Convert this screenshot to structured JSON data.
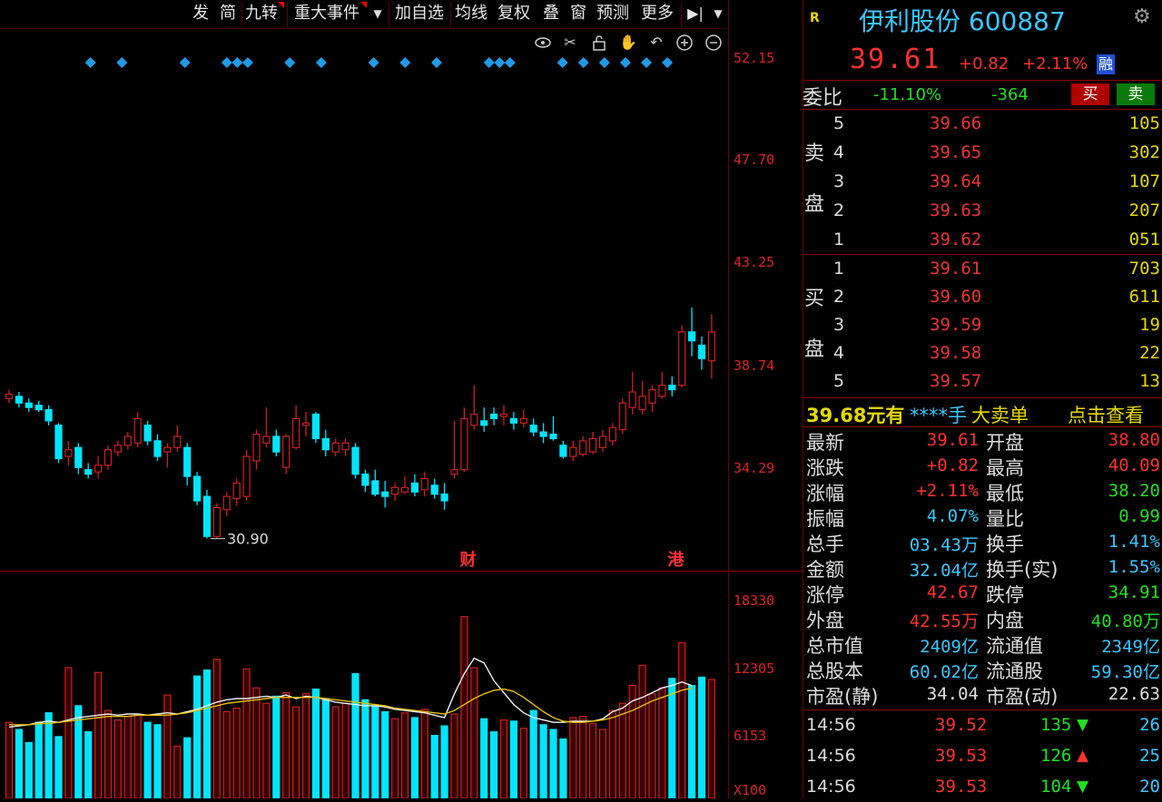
{
  "toolbar": {
    "items": [
      "发",
      "简",
      "九转",
      "重大事件",
      "加自选",
      "均线",
      "复权",
      "叠",
      "窗",
      "预测",
      "更多"
    ],
    "dropdown_icon": "chevron-down-icon",
    "play_icon": "skip-next-icon"
  },
  "chart_tools": [
    "eye-icon",
    "scissors-icon",
    "lock-icon",
    "hand-icon",
    "undo-icon",
    "zoom-in-icon",
    "zoom-out-icon"
  ],
  "price_axis": [
    "52.15",
    "47.70",
    "43.25",
    "38.74",
    "34.29"
  ],
  "volume_axis": [
    "18330",
    "12305",
    "6153",
    "X100"
  ],
  "low_marker": "30.90",
  "event_markers": [
    "财",
    "港"
  ],
  "chart_data": [
    {
      "type": "candlestick",
      "ylim": [
        29.5,
        53.5
      ],
      "low_label": "30.90",
      "candles": [
        {
          "o": 37.2,
          "c": 37.4,
          "h": 37.6,
          "l": 37.0
        },
        {
          "o": 37.3,
          "c": 37.0,
          "h": 37.5,
          "l": 36.8
        },
        {
          "o": 37.0,
          "c": 36.8,
          "h": 37.2,
          "l": 36.6
        },
        {
          "o": 36.9,
          "c": 36.7,
          "h": 37.1,
          "l": 36.6
        },
        {
          "o": 36.7,
          "c": 36.2,
          "h": 36.9,
          "l": 36.0
        },
        {
          "o": 36.0,
          "c": 34.5,
          "h": 36.1,
          "l": 34.3
        },
        {
          "o": 34.6,
          "c": 34.9,
          "h": 35.3,
          "l": 34.2
        },
        {
          "o": 35.0,
          "c": 34.1,
          "h": 35.2,
          "l": 33.8
        },
        {
          "o": 34.0,
          "c": 33.8,
          "h": 34.3,
          "l": 33.6
        },
        {
          "o": 33.9,
          "c": 34.2,
          "h": 34.6,
          "l": 33.6
        },
        {
          "o": 34.2,
          "c": 34.9,
          "h": 35.1,
          "l": 34.0
        },
        {
          "o": 34.8,
          "c": 35.1,
          "h": 35.3,
          "l": 34.6
        },
        {
          "o": 35.1,
          "c": 35.5,
          "h": 35.7,
          "l": 34.9
        },
        {
          "o": 35.2,
          "c": 36.3,
          "h": 36.6,
          "l": 35.0
        },
        {
          "o": 36.0,
          "c": 35.3,
          "h": 36.2,
          "l": 35.1
        },
        {
          "o": 35.3,
          "c": 34.6,
          "h": 35.6,
          "l": 34.4
        },
        {
          "o": 34.8,
          "c": 35.0,
          "h": 35.2,
          "l": 34.1
        },
        {
          "o": 35.0,
          "c": 35.5,
          "h": 36.0,
          "l": 34.8
        },
        {
          "o": 35.0,
          "c": 33.7,
          "h": 35.2,
          "l": 33.3
        },
        {
          "o": 33.7,
          "c": 32.6,
          "h": 33.9,
          "l": 32.4
        },
        {
          "o": 32.8,
          "c": 31.0,
          "h": 33.1,
          "l": 30.9
        },
        {
          "o": 31.0,
          "c": 32.3,
          "h": 32.5,
          "l": 30.9
        },
        {
          "o": 32.2,
          "c": 32.8,
          "h": 33.0,
          "l": 31.9
        },
        {
          "o": 32.7,
          "c": 33.4,
          "h": 33.6,
          "l": 32.4
        },
        {
          "o": 32.8,
          "c": 34.6,
          "h": 34.9,
          "l": 32.6
        },
        {
          "o": 34.4,
          "c": 35.6,
          "h": 35.8,
          "l": 34.0
        },
        {
          "o": 35.2,
          "c": 35.5,
          "h": 36.8,
          "l": 35.0
        },
        {
          "o": 35.5,
          "c": 34.8,
          "h": 35.8,
          "l": 34.6
        },
        {
          "o": 34.1,
          "c": 35.5,
          "h": 35.6,
          "l": 33.8
        },
        {
          "o": 35.0,
          "c": 36.3,
          "h": 36.9,
          "l": 34.9
        },
        {
          "o": 36.0,
          "c": 36.1,
          "h": 36.6,
          "l": 35.5
        },
        {
          "o": 36.5,
          "c": 35.4,
          "h": 36.6,
          "l": 35.2
        },
        {
          "o": 35.4,
          "c": 34.9,
          "h": 35.8,
          "l": 34.6
        },
        {
          "o": 34.8,
          "c": 35.2,
          "h": 35.4,
          "l": 34.6
        },
        {
          "o": 34.9,
          "c": 35.2,
          "h": 35.4,
          "l": 34.6
        },
        {
          "o": 35.0,
          "c": 33.8,
          "h": 35.2,
          "l": 33.6
        },
        {
          "o": 33.8,
          "c": 33.3,
          "h": 34.0,
          "l": 33.0
        },
        {
          "o": 33.5,
          "c": 32.9,
          "h": 34.0,
          "l": 32.8
        },
        {
          "o": 33.0,
          "c": 32.8,
          "h": 33.5,
          "l": 32.3
        },
        {
          "o": 32.9,
          "c": 33.2,
          "h": 33.4,
          "l": 32.6
        },
        {
          "o": 33.0,
          "c": 33.2,
          "h": 33.7,
          "l": 32.9
        },
        {
          "o": 33.4,
          "c": 33.0,
          "h": 33.8,
          "l": 32.8
        },
        {
          "o": 33.1,
          "c": 33.6,
          "h": 33.9,
          "l": 32.8
        },
        {
          "o": 33.3,
          "c": 32.9,
          "h": 33.6,
          "l": 32.7
        },
        {
          "o": 32.9,
          "c": 32.6,
          "h": 33.4,
          "l": 32.2
        },
        {
          "o": 33.8,
          "c": 34.0,
          "h": 36.2,
          "l": 33.6
        },
        {
          "o": 34.0,
          "c": 36.3,
          "h": 36.8,
          "l": 33.9
        },
        {
          "o": 36.0,
          "c": 36.5,
          "h": 37.8,
          "l": 35.8
        },
        {
          "o": 36.2,
          "c": 36.0,
          "h": 36.8,
          "l": 35.7
        },
        {
          "o": 36.5,
          "c": 36.3,
          "h": 36.8,
          "l": 36.0
        },
        {
          "o": 36.4,
          "c": 36.5,
          "h": 36.9,
          "l": 36.0
        },
        {
          "o": 36.3,
          "c": 36.1,
          "h": 36.6,
          "l": 35.8
        },
        {
          "o": 36.1,
          "c": 36.3,
          "h": 36.7,
          "l": 35.9
        },
        {
          "o": 36.0,
          "c": 35.7,
          "h": 36.3,
          "l": 35.5
        },
        {
          "o": 35.7,
          "c": 35.5,
          "h": 36.1,
          "l": 35.2
        },
        {
          "o": 35.6,
          "c": 35.4,
          "h": 36.4,
          "l": 35.3
        },
        {
          "o": 35.1,
          "c": 34.6,
          "h": 35.3,
          "l": 34.5
        },
        {
          "o": 34.6,
          "c": 35.0,
          "h": 35.3,
          "l": 34.4
        },
        {
          "o": 34.7,
          "c": 35.3,
          "h": 35.5,
          "l": 34.6
        },
        {
          "o": 34.8,
          "c": 35.4,
          "h": 35.7,
          "l": 34.7
        },
        {
          "o": 35.0,
          "c": 35.5,
          "h": 35.8,
          "l": 34.8
        },
        {
          "o": 35.3,
          "c": 35.9,
          "h": 36.1,
          "l": 35.1
        },
        {
          "o": 35.8,
          "c": 37.0,
          "h": 37.2,
          "l": 35.6
        },
        {
          "o": 36.8,
          "c": 37.5,
          "h": 38.4,
          "l": 36.5
        },
        {
          "o": 36.7,
          "c": 37.3,
          "h": 38.0,
          "l": 36.5
        },
        {
          "o": 37.0,
          "c": 37.6,
          "h": 37.8,
          "l": 36.6
        },
        {
          "o": 37.3,
          "c": 37.8,
          "h": 38.4,
          "l": 37.2
        },
        {
          "o": 37.8,
          "c": 37.6,
          "h": 38.2,
          "l": 37.3
        },
        {
          "o": 37.8,
          "c": 40.2,
          "h": 40.5,
          "l": 37.7
        },
        {
          "o": 40.2,
          "c": 39.8,
          "h": 41.3,
          "l": 39.1
        },
        {
          "o": 39.6,
          "c": 39.0,
          "h": 40.0,
          "l": 38.5
        },
        {
          "o": 38.9,
          "c": 40.2,
          "h": 41.0,
          "l": 38.1
        }
      ],
      "event_days": [
        {
          "label": "财",
          "index": 45
        },
        {
          "label": "港",
          "index": 66
        }
      ],
      "signal_days": [
        3,
        6,
        12,
        16,
        17,
        18,
        22,
        25,
        30,
        33,
        36,
        41,
        42,
        43,
        48,
        50,
        52,
        54,
        56,
        58
      ]
    },
    {
      "type": "bar",
      "title": "volume",
      "ylim": [
        0,
        18330
      ],
      "values": [
        6400,
        5800,
        4700,
        6400,
        7200,
        5200,
        11000,
        7800,
        5600,
        10600,
        7400,
        6600,
        6900,
        7000,
        6400,
        6200,
        8700,
        4400,
        5100,
        10300,
        10800,
        11700,
        7300,
        7600,
        10900,
        9300,
        8000,
        8600,
        8900,
        7700,
        8800,
        9200,
        8400,
        7700,
        8000,
        10500,
        8300,
        7800,
        7300,
        6700,
        7200,
        6800,
        7500,
        5300,
        6100,
        7100,
        15300,
        11000,
        6700,
        5600,
        6600,
        6500,
        5900,
        7400,
        6200,
        5800,
        5000,
        6800,
        6900,
        6300,
        5800,
        7400,
        8000,
        9500,
        11200,
        8800,
        9300,
        10100,
        13100,
        9500,
        10200,
        10000
      ],
      "ma_series": [
        {
          "values": [
            6000,
            6100,
            6200,
            6400,
            6500,
            6400,
            6600,
            6800,
            6900,
            7000,
            7100,
            7000,
            7100,
            7100,
            7000,
            7100,
            7200,
            7100,
            7300,
            7500,
            7800,
            8100,
            8300,
            8400,
            8400,
            8500,
            8600,
            8500,
            8700,
            8400,
            8600,
            8500,
            8300,
            8100,
            8000,
            7900,
            7800,
            7800,
            7700,
            7500,
            7400,
            7300,
            7200,
            7000,
            6800,
            8800,
            10500,
            11800,
            11400,
            9900,
            8900,
            7900,
            7200,
            6800,
            6600,
            6400,
            6400,
            6500,
            6500,
            6500,
            6700,
            7300,
            7600,
            8200,
            8500,
            8900,
            9300,
            9500,
            9800,
            9500
          ]
        },
        {
          "values": [
            6200,
            6200,
            6200,
            6300,
            6300,
            6400,
            6500,
            6600,
            6700,
            6800,
            6900,
            6900,
            6900,
            7000,
            7000,
            7000,
            7000,
            7100,
            7200,
            7400,
            7600,
            7800,
            8000,
            8100,
            8200,
            8300,
            8400,
            8500,
            8500,
            8500,
            8500,
            8500,
            8400,
            8300,
            8200,
            8100,
            8000,
            7900,
            7800,
            7600,
            7500,
            7400,
            7300,
            7200,
            7100,
            7400,
            7900,
            8400,
            8800,
            9100,
            9200,
            9000,
            8500,
            7900,
            7300,
            6800,
            6500,
            6400,
            6400,
            6500,
            6600,
            6800,
            7100,
            7400,
            7800,
            8200,
            8500,
            8800,
            9100,
            9300
          ]
        }
      ],
      "colors": {
        "up": "#cc2020",
        "down": "#00e5ff",
        "ma5": "#f0f0f0",
        "ma10": "#e8c000"
      }
    }
  ],
  "quote": {
    "r_badge": "R",
    "title": "伊利股份 600887",
    "price": "39.61",
    "change": "+0.82",
    "pct": "+2.11%",
    "tag": "融",
    "ratio_label": "委比",
    "ratio_pct": "-11.10%",
    "ratio_diff": "-364",
    "buy_btn": "买",
    "sell_btn": "卖",
    "sell_side_label": "卖盘",
    "buy_side_label": "买盘",
    "sell": [
      {
        "lvl": "5",
        "px": "39.66",
        "vol": "105"
      },
      {
        "lvl": "4",
        "px": "39.65",
        "vol": "302"
      },
      {
        "lvl": "3",
        "px": "39.64",
        "vol": "107"
      },
      {
        "lvl": "2",
        "px": "39.63",
        "vol": "207"
      },
      {
        "lvl": "1",
        "px": "39.62",
        "vol": "051"
      }
    ],
    "buy": [
      {
        "lvl": "1",
        "px": "39.61",
        "vol": "703"
      },
      {
        "lvl": "2",
        "px": "39.60",
        "vol": "611"
      },
      {
        "lvl": "3",
        "px": "39.59",
        "vol": "19"
      },
      {
        "lvl": "4",
        "px": "39.58",
        "vol": "22"
      },
      {
        "lvl": "5",
        "px": "39.57",
        "vol": "13"
      }
    ],
    "big": {
      "price": "39.68元有",
      "stars": "****手",
      "type": "大卖单",
      "link": "点击查看"
    }
  },
  "stats": [
    {
      "l1": "最新",
      "v1": "39.61",
      "c1": "#ff3030",
      "l2": "开盘",
      "v2": "38.80",
      "c2": "#ff3030"
    },
    {
      "l1": "涨跌",
      "v1": "+0.82",
      "c1": "#ff3030",
      "l2": "最高",
      "v2": "40.09",
      "c2": "#ff3030"
    },
    {
      "l1": "涨幅",
      "v1": "+2.11%",
      "c1": "#ff3030",
      "l2": "最低",
      "v2": "38.20",
      "c2": "#20e020"
    },
    {
      "l1": "振幅",
      "v1": "4.07%",
      "c1": "#38c8ff",
      "l2": "量比",
      "v2": "0.99",
      "c2": "#20e020"
    },
    {
      "l1": "总手",
      "v1": "03.43万",
      "c1": "#38c8ff",
      "l2": "换手",
      "v2": "1.41%",
      "c2": "#38c8ff"
    },
    {
      "l1": "金额",
      "v1": "32.04亿",
      "c1": "#38c8ff",
      "l2": "换手(实)",
      "v2": "1.55%",
      "c2": "#38c8ff"
    },
    {
      "l1": "涨停",
      "v1": "42.67",
      "c1": "#ff3030",
      "l2": "跌停",
      "v2": "34.91",
      "c2": "#20e020"
    },
    {
      "l1": "外盘",
      "v1": "42.55万",
      "c1": "#ff3030",
      "l2": "内盘",
      "v2": "40.80万",
      "c2": "#20e020"
    },
    {
      "l1": "总市值",
      "v1": "2409亿",
      "c1": "#38c8ff",
      "l2": "流通值",
      "v2": "2349亿",
      "c2": "#38c8ff"
    },
    {
      "l1": "总股本",
      "v1": "60.02亿",
      "c1": "#38c8ff",
      "l2": "流通股",
      "v2": "59.30亿",
      "c2": "#38c8ff"
    },
    {
      "l1": "市盈(静)",
      "v1": "34.04",
      "c1": "#e0e0e0",
      "l2": "市盈(动)",
      "v2": "22.63",
      "c2": "#e0e0e0"
    }
  ],
  "ticks": [
    {
      "time": "14:56",
      "px": "39.52",
      "vol": "135",
      "dir": "down",
      "n": "26"
    },
    {
      "time": "14:56",
      "px": "39.53",
      "vol": "126",
      "dir": "up",
      "n": "25"
    },
    {
      "time": "14:56",
      "px": "39.53",
      "vol": "104",
      "dir": "down",
      "n": "20"
    }
  ],
  "gear_icon": "gear-icon"
}
